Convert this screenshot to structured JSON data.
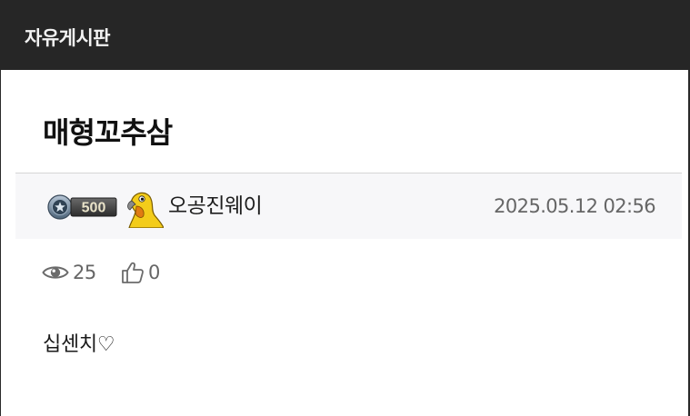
{
  "board": {
    "title": "자유게시판"
  },
  "post": {
    "title": "매형꼬추삼",
    "author": {
      "level": "500",
      "name": "오공진웨이",
      "avatar_icon": "yellow-parrot-avatar"
    },
    "date": "2025.05.12 02:56",
    "stats": {
      "views": "25",
      "likes": "0",
      "views_icon": "eye-icon",
      "likes_icon": "thumbs-up-icon"
    },
    "body": "십센치♡"
  },
  "colors": {
    "topbar_bg": "#262626",
    "topbar_text": "#f2f2f2",
    "meta_bg": "#f7f7f9",
    "muted_text": "#666666",
    "avatar_yellow": "#f3cc1a"
  }
}
